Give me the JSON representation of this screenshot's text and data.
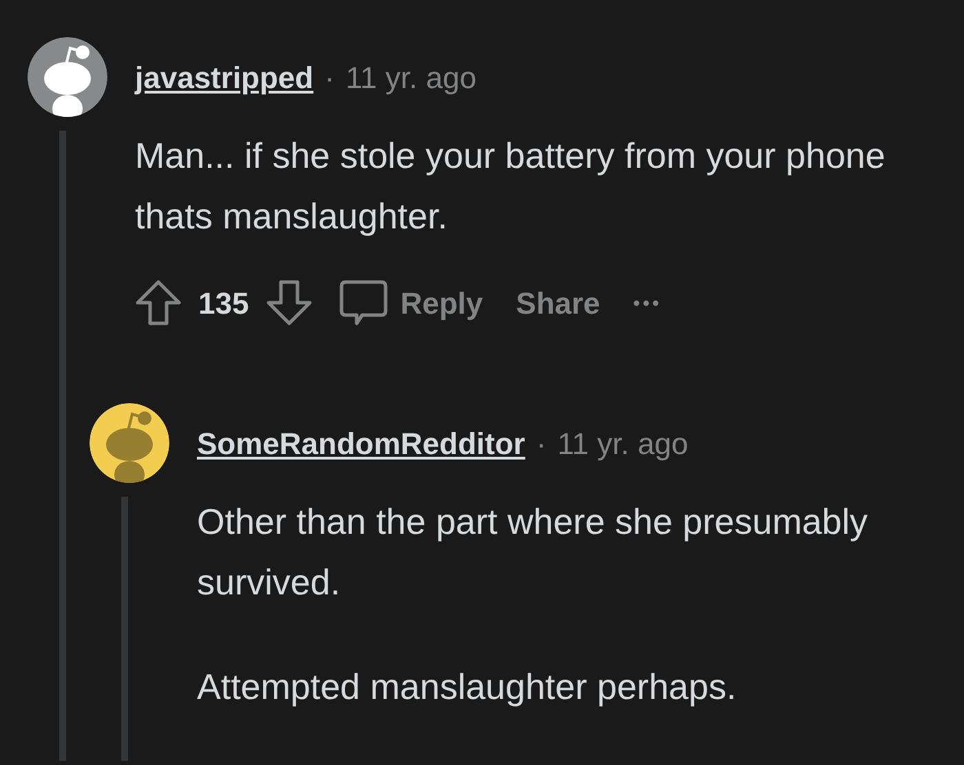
{
  "comments": [
    {
      "author": "javastripped",
      "separator": "·",
      "time": "11 yr. ago",
      "color": "#878a8c",
      "paragraphs": [
        "Man... if she stole your battery from your phone thats manslaughter."
      ],
      "actions": {
        "score": "135",
        "reply": "Reply",
        "share": "Share",
        "more": "•••"
      },
      "children": [
        {
          "author": "SomeRandomRedditor",
          "separator": "·",
          "time": "11 yr. ago",
          "color": "#f2cd4f",
          "paragraphs": [
            "Other than the part where she presumably survived.",
            "Attempted manslaughter perhaps."
          ]
        }
      ]
    }
  ]
}
